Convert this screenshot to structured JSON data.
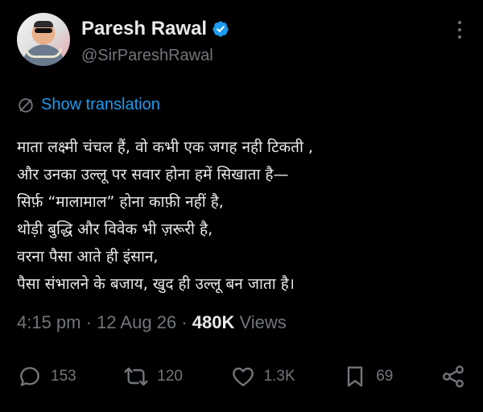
{
  "author": {
    "display_name": "Paresh Rawal",
    "handle": "@SirPareshRawal",
    "verified": true
  },
  "translate_label": "Show translation",
  "tweet_lines": [
    "माता लक्ष्मी चंचल हैं, वो कभी एक जगह नही टिकती ,",
    "और उनका उल्लू पर सवार होना हमें सिखाता है—",
    "सिर्फ़ “मालामाल” होना काफ़ी नहीं है,",
    "थोड़ी बुद्धि और विवेक भी ज़रूरी है,",
    "वरना पैसा आते ही इंसान,",
    "पैसा संभालने के बजाय, खुद ही उल्लू बन जाता है।"
  ],
  "meta": {
    "time": "4:15 pm",
    "separator": " · ",
    "date": "12 Aug 26",
    "views_count": "480K",
    "views_label": "Views"
  },
  "actions": {
    "replies": "153",
    "retweets": "120",
    "likes": "1.3K",
    "bookmarks": "69"
  },
  "colors": {
    "background": "#000000",
    "text": "#e7e9ea",
    "muted": "#71767b",
    "accent": "#1d9bf0"
  },
  "icons": [
    "verified-badge-icon",
    "more-icon",
    "translate-icon",
    "reply-icon",
    "retweet-icon",
    "like-icon",
    "bookmark-icon",
    "share-icon"
  ]
}
